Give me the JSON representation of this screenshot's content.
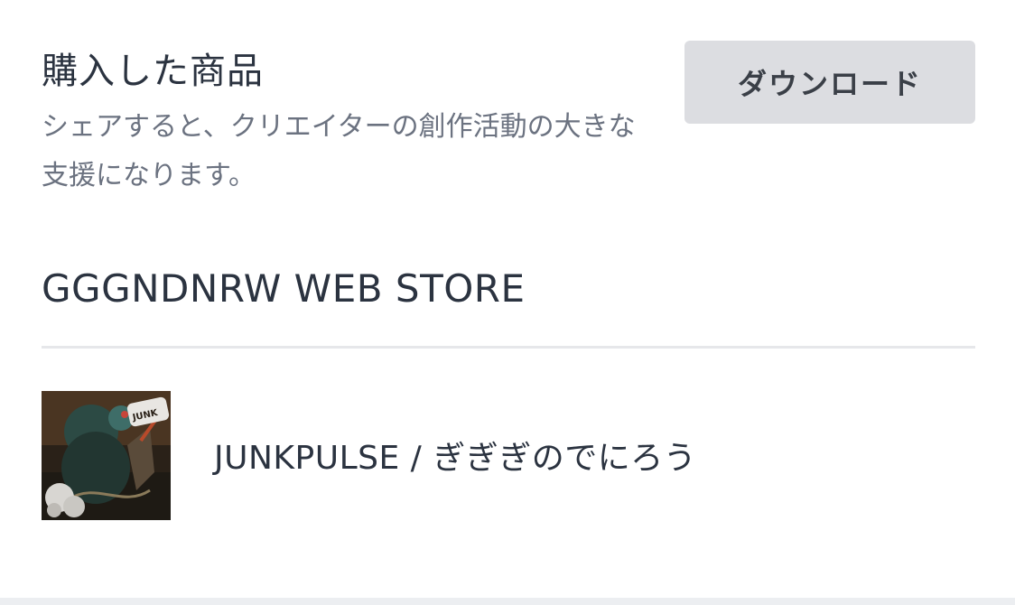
{
  "header": {
    "title": "購入した商品",
    "subtitle": "シェアすると、クリエイターの創作活動の大きな支援になります。",
    "download_label": "ダウンロード"
  },
  "store": {
    "name": "GGGNDNRW WEB STORE"
  },
  "products": [
    {
      "title": "JUNKPULSE / ぎぎぎのでにろう",
      "thumbnail": "album-cover-artwork"
    }
  ]
}
